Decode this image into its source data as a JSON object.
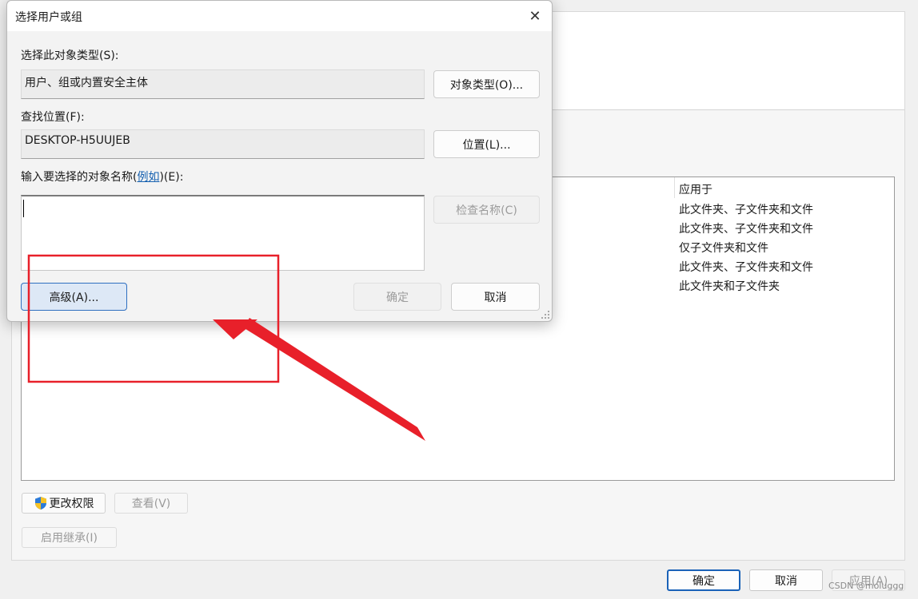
{
  "dialog": {
    "title": "选择用户或组",
    "object_type_label": "选择此对象类型(S):",
    "object_type_value": "用户、组或内置安全主体",
    "object_type_button": "对象类型(O)...",
    "location_label": "查找位置(F):",
    "location_value": "DESKTOP-H5UUJEB",
    "location_button": "位置(L)...",
    "enter_names_label_prefix": "输入要选择的对象名称(",
    "enter_names_link": "例如",
    "enter_names_label_suffix": ")(E):",
    "enter_names_value": "",
    "check_names_button": "检查名称(C)",
    "advanced_button": "高级(A)...",
    "ok_button": "确定",
    "cancel_button": "取消"
  },
  "background": {
    "permissions": {
      "column_header": "应用于",
      "rows": [
        "此文件夹、子文件夹和文件",
        "此文件夹、子文件夹和文件",
        "仅子文件夹和文件",
        "此文件夹、子文件夹和文件",
        "此文件夹和子文件夹"
      ]
    },
    "change_permissions_button": "更改权限",
    "view_button": "查看(V)",
    "enable_inheritance_button": "启用继承(I)",
    "ok_button": "确定",
    "cancel_button": "取消",
    "apply_button": "应用(A)"
  },
  "watermark": "CSDN @moluggg",
  "colors": {
    "annotation_red": "#e8202a",
    "focus_blue": "#2f6fc0",
    "link_blue": "#1560b0"
  }
}
